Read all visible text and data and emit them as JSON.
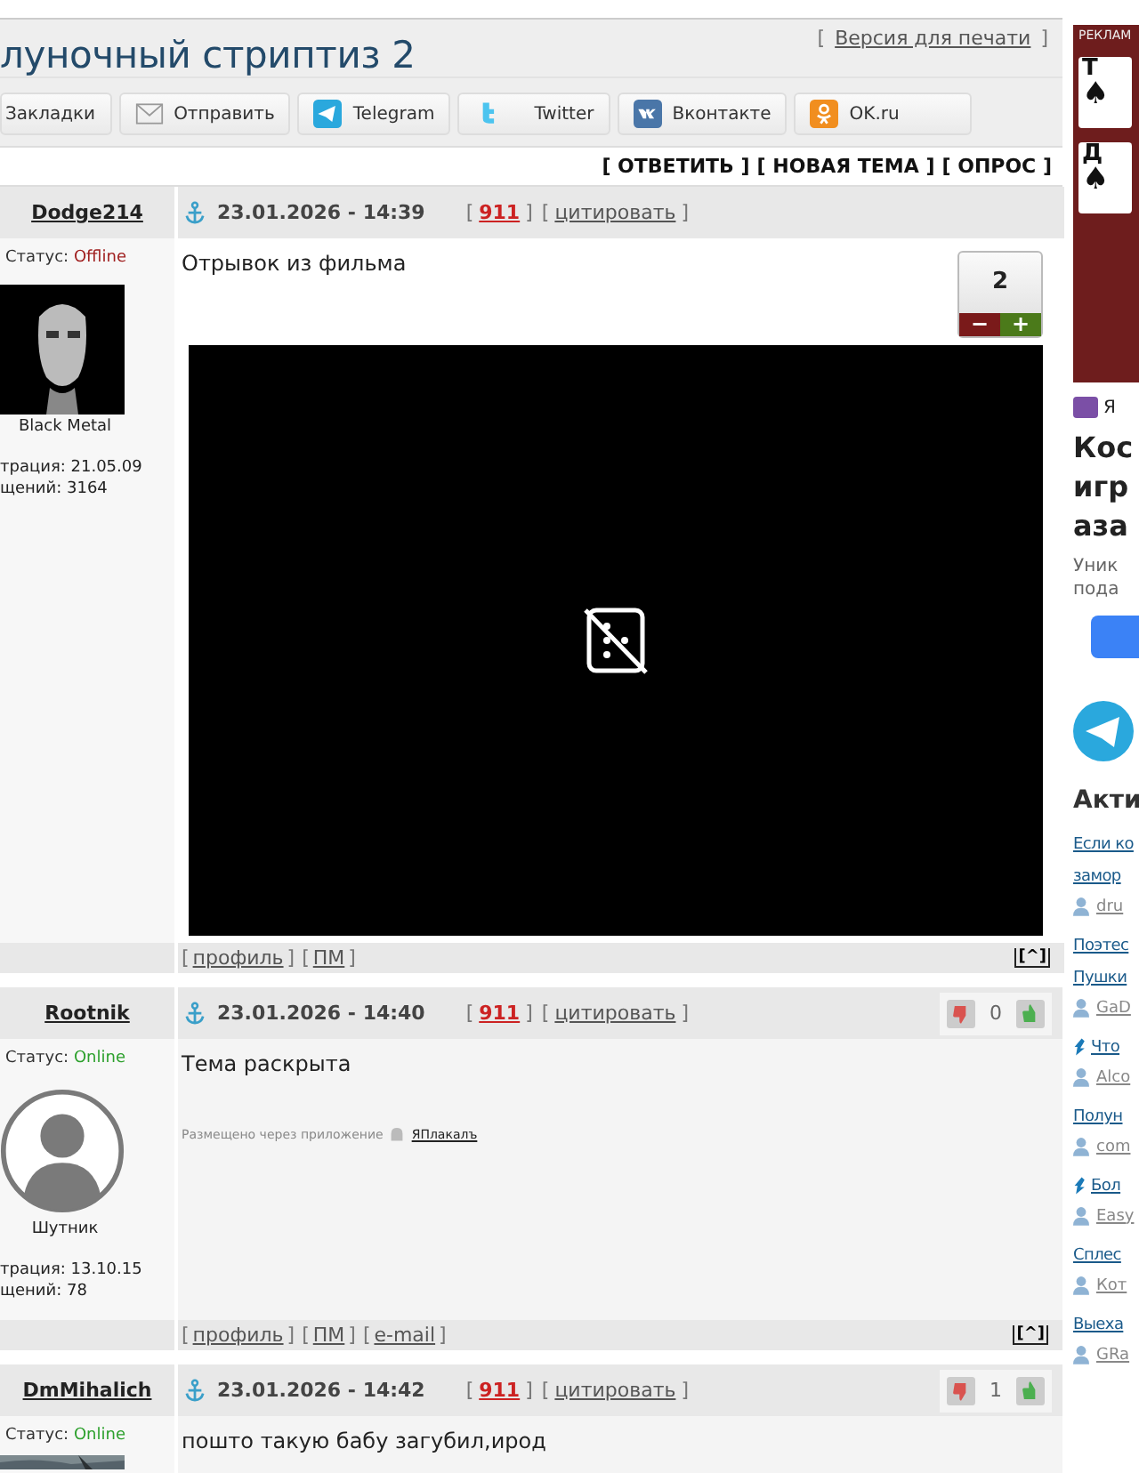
{
  "bracket_open": "[",
  "bracket_close": "]",
  "topic": {
    "title": "луночный стриптиз 2",
    "print_link": "Версия для печати"
  },
  "share_buttons": [
    {
      "label": "Закладки",
      "kind": "bookmark"
    },
    {
      "label": "Отправить",
      "kind": "mail"
    },
    {
      "label": "Telegram",
      "kind": "telegram"
    },
    {
      "label": "Twitter",
      "kind": "twitter"
    },
    {
      "label": "Вконтакте",
      "kind": "vk"
    },
    {
      "label": "OK.ru",
      "kind": "ok"
    }
  ],
  "actions": [
    "ОТВЕТИТЬ",
    "НОВАЯ ТЕМА",
    "ОПРОС"
  ],
  "posts": [
    {
      "author": "Dodge214",
      "status_label": "Статус:",
      "status": "Offline",
      "online": false,
      "avatar": {
        "kind": "picture"
      },
      "rank": "Black Metal",
      "registered": "трация: 21.05.09",
      "messages": "щений: 3164",
      "date": "23.01.2026 - 14:39",
      "number": "911",
      "quote": "цитировать",
      "body": "Отрывок из фильма",
      "attachment": {
        "kind": "video"
      },
      "rating": {
        "kind": "box",
        "value": "2",
        "minus": "−",
        "plus": "+"
      },
      "footer_links": [
        "профиль",
        "ПМ"
      ],
      "top": "[^]"
    },
    {
      "author": "Rootnik",
      "status_label": "Статус:",
      "status": "Online",
      "online": true,
      "avatar": {
        "kind": "silhouette"
      },
      "rank": "Шутник",
      "registered": "трация: 13.10.15",
      "messages": "щений: 78",
      "date": "23.01.2026 - 14:40",
      "number": "911",
      "quote": "цитировать",
      "body": "Тема раскрыта",
      "via": {
        "text": "Размещено через приложение",
        "app": "ЯПлакалъ"
      },
      "rating": {
        "kind": "thumbs",
        "value": "0"
      },
      "footer_links": [
        "профиль",
        "ПМ",
        "e-mail"
      ],
      "top": "[^]"
    },
    {
      "author": "DmMihalich",
      "status_label": "Статус:",
      "status": "Online",
      "online": true,
      "avatar": {
        "kind": "picture"
      },
      "date": "23.01.2026 - 14:42",
      "number": "911",
      "quote": "цитировать",
      "body": "пошто такую бабу загубил,ирод",
      "rating": {
        "kind": "thumbs",
        "value": "1"
      }
    }
  ],
  "sidebar": {
    "ad": {
      "label": "РЕКЛАМ",
      "cards": [
        {
          "rank": "Т",
          "suit": "♠"
        },
        {
          "rank": "Д",
          "suit": "♠"
        }
      ],
      "source": "Я",
      "headline": [
        "Кос",
        "игр",
        "аза"
      ],
      "text": [
        "Уник",
        "пода"
      ]
    },
    "section_title": "Акти",
    "topics": [
      {
        "lines": [
          "Если ко",
          "замор"
        ],
        "user": "dru",
        "hot": false
      },
      {
        "lines": [
          "Поэтес",
          "Пушки"
        ],
        "user": "GaD",
        "hot": false
      },
      {
        "lines": [
          "Что"
        ],
        "user": "Alco",
        "hot": true
      },
      {
        "lines": [
          "Полун"
        ],
        "user": "com",
        "hot": false
      },
      {
        "lines": [
          "Бол"
        ],
        "user": "Easy",
        "hot": true
      },
      {
        "lines": [
          "Сплес"
        ],
        "user": "Кот",
        "hot": false
      },
      {
        "lines": [
          "Выеха"
        ],
        "user": "GRa",
        "hot": false
      }
    ]
  }
}
